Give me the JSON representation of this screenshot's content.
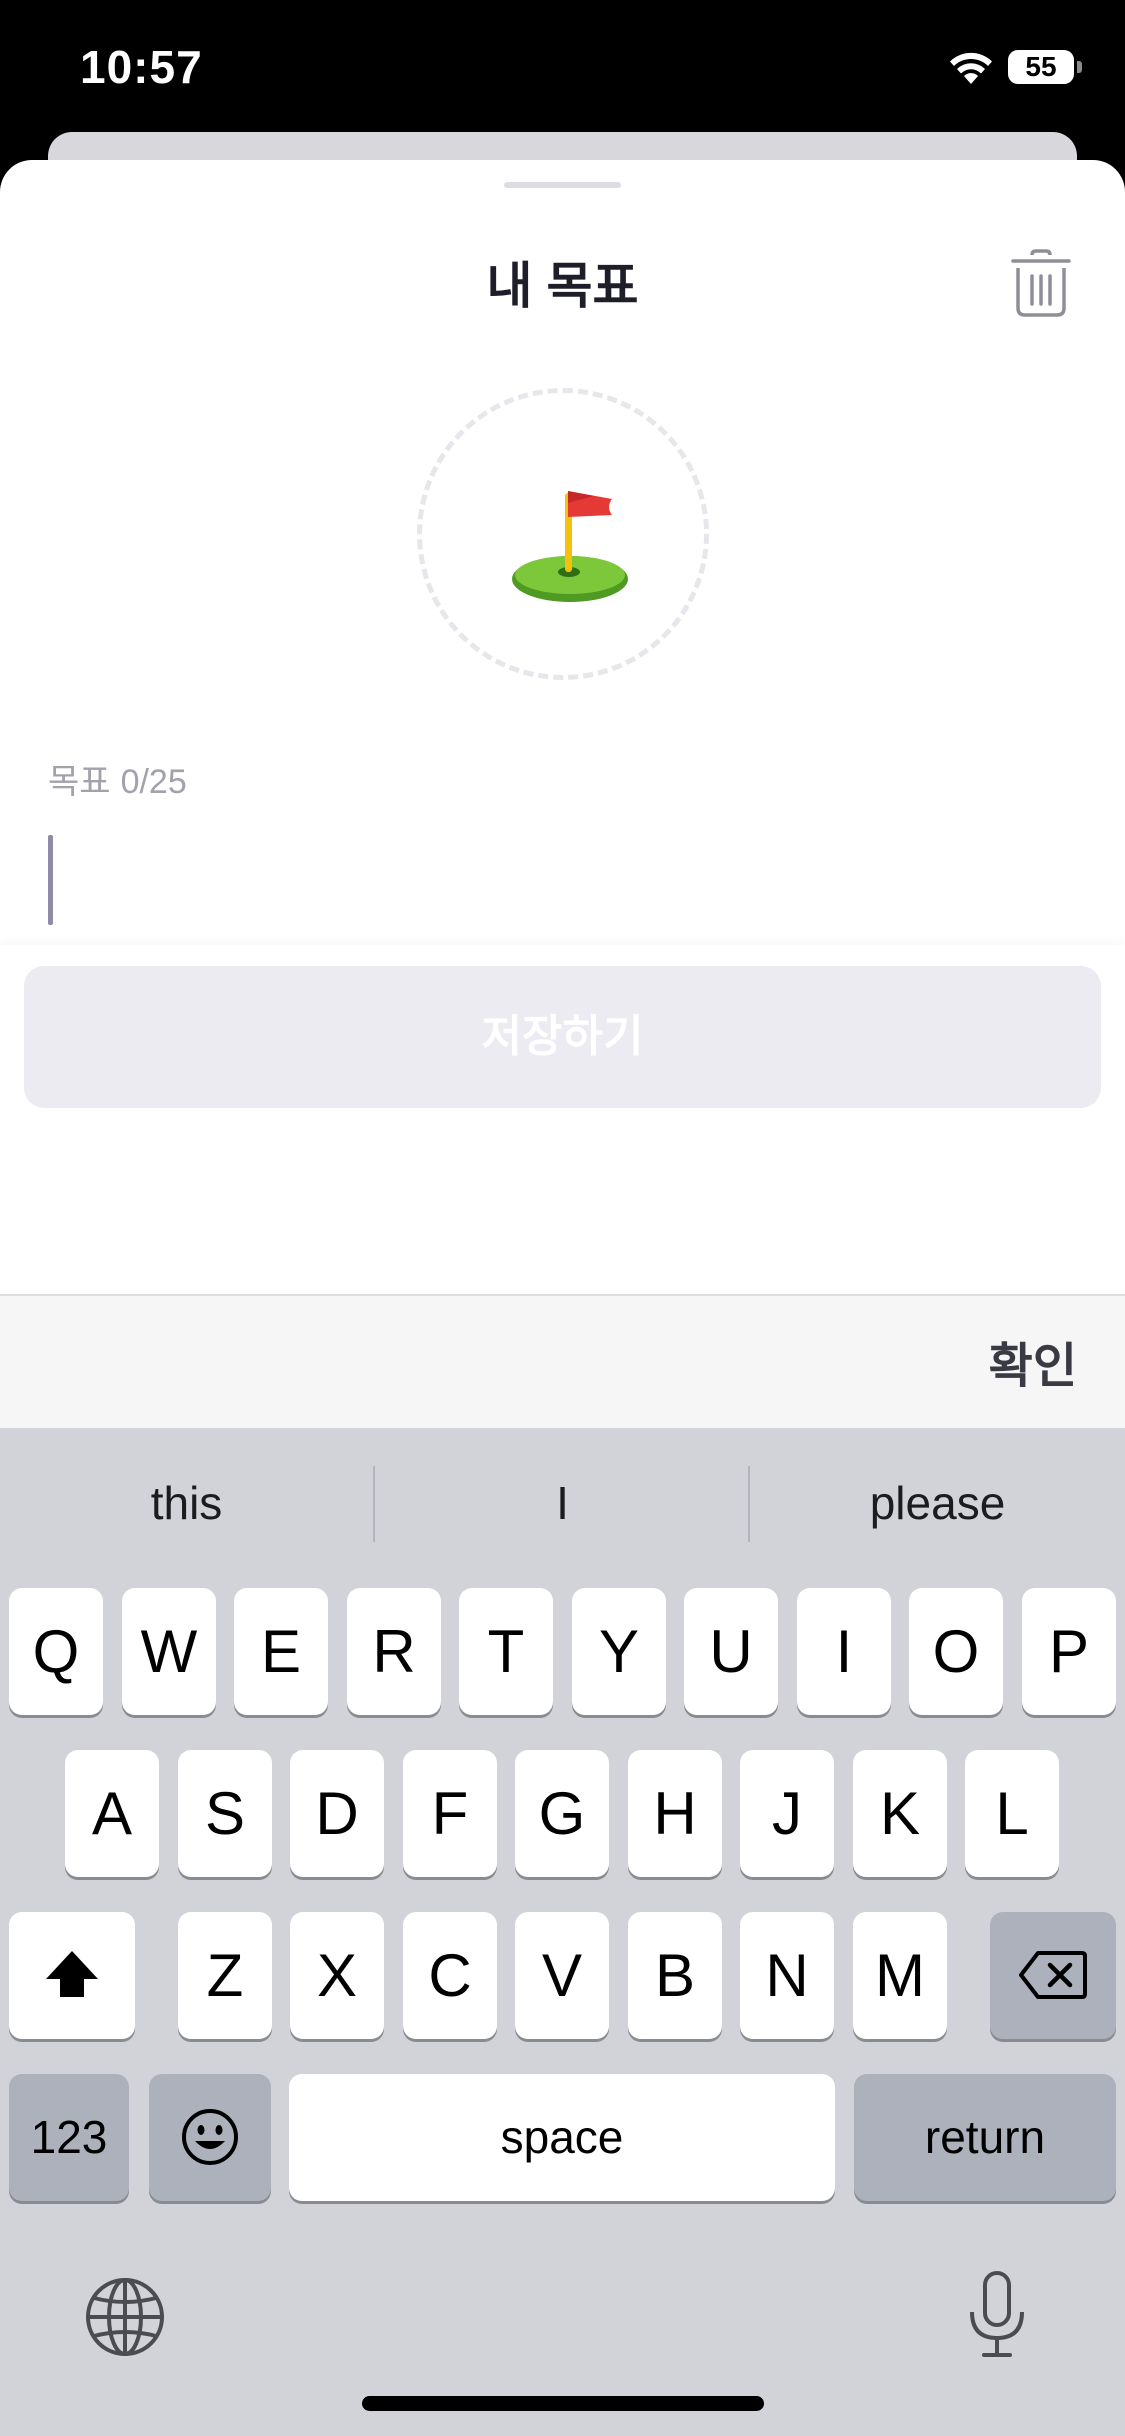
{
  "status_bar": {
    "time": "10:57",
    "battery": "55",
    "icons": [
      "wifi-icon",
      "battery-icon"
    ]
  },
  "sheet": {
    "title": "내 목표",
    "delete_icon": "trash-icon",
    "goal_emoji": "flag-in-hole",
    "goal_label": "목표",
    "goal_count": "0/25",
    "goal_value": "",
    "save_label": "저장하기"
  },
  "accessory": {
    "confirm_label": "확인"
  },
  "keyboard": {
    "suggestions": [
      "this",
      "I",
      "please"
    ],
    "row1": [
      "Q",
      "W",
      "E",
      "R",
      "T",
      "Y",
      "U",
      "I",
      "O",
      "P"
    ],
    "row2": [
      "A",
      "S",
      "D",
      "F",
      "G",
      "H",
      "J",
      "K",
      "L"
    ],
    "row3": [
      "Z",
      "X",
      "C",
      "V",
      "B",
      "N",
      "M"
    ],
    "numbers_label": "123",
    "space_label": "space",
    "return_label": "return",
    "icons": [
      "shift-icon",
      "delete-icon",
      "emoji-icon",
      "globe-icon",
      "microphone-icon"
    ]
  },
  "colors": {
    "save_disabled_bg": "#ECEBF1",
    "keyboard_bg": "#D1D3D9",
    "caret": "#8F8CA8"
  }
}
